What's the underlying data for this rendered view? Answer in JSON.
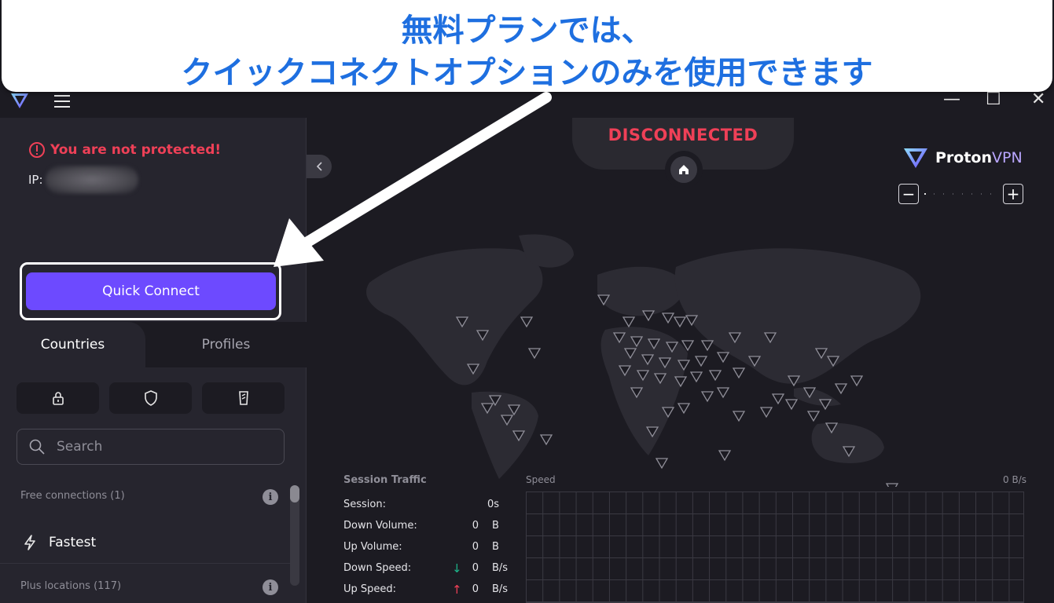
{
  "annotation": {
    "line1": "無料プランでは、",
    "line2": "クイックコネクトオプションのみを使用できます"
  },
  "window": {
    "minimize": "—",
    "maximize": "☐",
    "close": "✕"
  },
  "sidebar": {
    "status": "You are not protected!",
    "ip_label": "IP:",
    "quick_connect": "Quick Connect",
    "tabs": [
      {
        "label": "Countries"
      },
      {
        "label": "Profiles"
      }
    ],
    "filters": [
      "lock-icon",
      "shield-icon",
      "tor-icon"
    ],
    "search_placeholder": "Search",
    "free_section": "Free connections (1)",
    "fastest": "Fastest",
    "plus_section": "Plus locations (117)",
    "info": "i"
  },
  "main": {
    "status": "DISCONNECTED",
    "brand_main": "Proton",
    "brand_vpn": "VPN",
    "zoom_out": "−",
    "zoom_in": "+"
  },
  "traffic": {
    "title": "Session Traffic",
    "rows": [
      {
        "label": "Session:",
        "value": "0s",
        "unit": ""
      },
      {
        "label": "Down Volume:",
        "value": "0",
        "unit": "B"
      },
      {
        "label": "Up Volume:",
        "value": "0",
        "unit": "B"
      },
      {
        "label": "Down Speed:",
        "value": "0",
        "unit": "B/s"
      },
      {
        "label": "Up Speed:",
        "value": "0",
        "unit": "B/s"
      }
    ],
    "speed_label": "Speed",
    "speed_max": "0  B/s"
  },
  "colors": {
    "accent": "#6d4aff",
    "danger": "#ef4057",
    "annotation": "#1e6fe0"
  }
}
